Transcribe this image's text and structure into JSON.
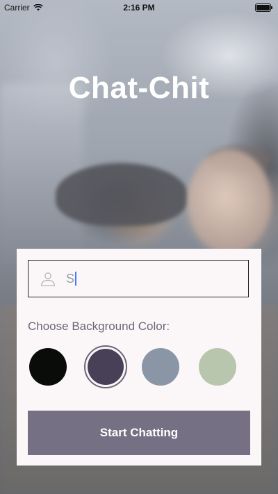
{
  "status_bar": {
    "carrier": "Carrier",
    "time": "2:16 PM"
  },
  "app": {
    "title": "Chat-Chit"
  },
  "form": {
    "name_input": {
      "value": "S",
      "icon": "person-icon"
    },
    "choose_label": "Choose Background Color:",
    "colors": [
      {
        "name": "black",
        "hex": "#090C08",
        "selected": false
      },
      {
        "name": "purple",
        "hex": "#474056",
        "selected": true
      },
      {
        "name": "slate",
        "hex": "#8A95A5",
        "selected": false
      },
      {
        "name": "sage",
        "hex": "#B9C6AE",
        "selected": false
      }
    ],
    "start_button": {
      "label": "Start Chatting",
      "color": "#757083"
    }
  }
}
